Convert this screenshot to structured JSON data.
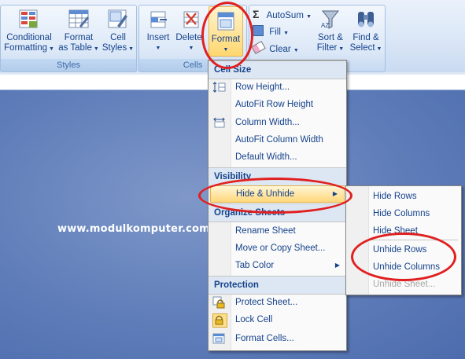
{
  "ribbon": {
    "styles_group": {
      "label": "Styles",
      "conditional_formatting": {
        "line1": "Conditional",
        "line2": "Formatting"
      },
      "format_as_table": {
        "line1": "Format",
        "line2": "as Table"
      },
      "cell_styles": {
        "line1": "Cell",
        "line2": "Styles"
      }
    },
    "cells_group": {
      "label": "Cells",
      "insert": "Insert",
      "delete": "Delete",
      "format": "Format"
    },
    "editing_group": {
      "autosum": "AutoSum",
      "fill": "Fill",
      "clear": "Clear",
      "sort_filter": {
        "line1": "Sort &",
        "line2": "Filter"
      },
      "find_select": {
        "line1": "Find &",
        "line2": "Select"
      }
    }
  },
  "watermark": "www.modulkomputer.com",
  "format_menu": {
    "cell_size": {
      "header": "Cell Size",
      "row_height": "Row Height...",
      "autofit_row_height": "AutoFit Row Height",
      "column_width": "Column Width...",
      "autofit_column_width": "AutoFit Column Width",
      "default_width": "Default Width..."
    },
    "visibility": {
      "header": "Visibility",
      "hide_unhide": "Hide & Unhide"
    },
    "organize": {
      "header": "Organize Sheets",
      "rename_sheet": "Rename Sheet",
      "move_copy": "Move or Copy Sheet...",
      "tab_color": "Tab Color"
    },
    "protection": {
      "header": "Protection",
      "protect_sheet": "Protect Sheet...",
      "lock_cell": "Lock Cell",
      "format_cells": "Format Cells..."
    }
  },
  "submenu": {
    "hide_rows": "Hide Rows",
    "hide_columns": "Hide Columns",
    "hide_sheet": "Hide Sheet",
    "unhide_rows": "Unhide Rows",
    "unhide_columns": "Unhide Columns",
    "unhide_sheet": "Unhide Sheet..."
  },
  "colors": {
    "annotation": "#e02020",
    "highlight": "#ffd77a",
    "menu_text": "#15428b"
  }
}
